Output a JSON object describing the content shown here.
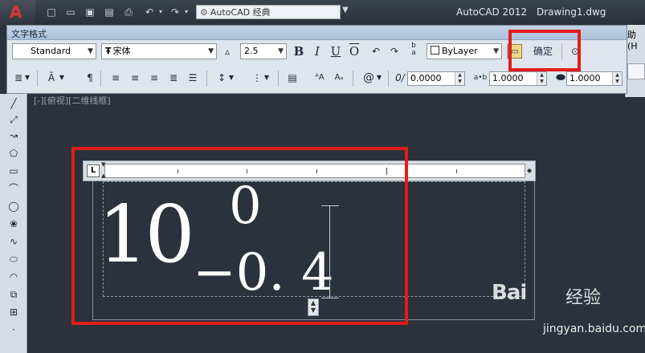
{
  "titlebar": {
    "workspace": "AutoCAD 经典",
    "app_title": "AutoCAD 2012",
    "document": "Drawing1.dwg"
  },
  "panel": {
    "title": "文字格式",
    "style": "Standard",
    "font": "宋体",
    "height": "2.5",
    "bold": "B",
    "italic": "I",
    "underline": "U",
    "overline": "O",
    "color": "ByLayer",
    "ok_label": "确定",
    "oblique_value": "0.0000",
    "tracking_value": "1.0000",
    "width_value": "1.0000"
  },
  "right_strip": {
    "text": "助(H"
  },
  "viewport_label": "[-][俯视][二维线框]",
  "editor": {
    "main_text": "10",
    "stack_upper": "0",
    "stack_lower": "−0. 4",
    "tab_type": "L"
  },
  "watermark": {
    "logo": "Bai",
    "brand": "经验",
    "url": "jingyan.baidu.com"
  },
  "colors": {
    "highlight": "#e01d1d",
    "canvas": "#2b323d",
    "panel": "#dfe5ec"
  }
}
